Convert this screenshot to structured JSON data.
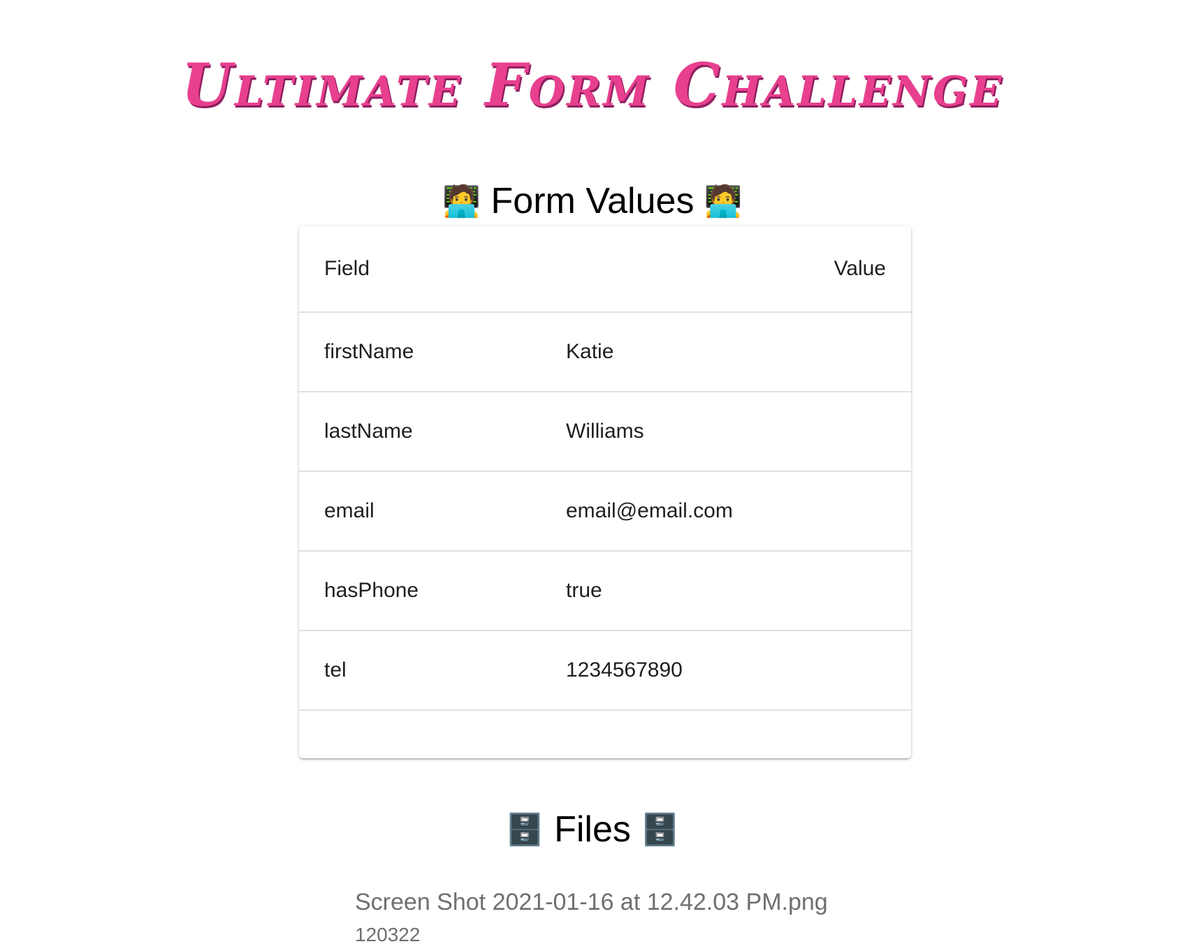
{
  "title": "Ultimate Form Challenge",
  "form_values": {
    "heading_emoji": "🧑‍💻",
    "heading": "Form Values",
    "columns": [
      "Field",
      "Value"
    ],
    "rows": [
      {
        "field": "firstName",
        "value": "Katie"
      },
      {
        "field": "lastName",
        "value": "Williams"
      },
      {
        "field": "email",
        "value": "email@email.com"
      },
      {
        "field": "hasPhone",
        "value": "true"
      },
      {
        "field": "tel",
        "value": "1234567890"
      }
    ]
  },
  "files": {
    "heading_emoji": "🗄️",
    "heading": "Files",
    "items": [
      {
        "name": "Screen Shot 2021-01-16 at 12.42.03 PM.png",
        "size": "120322"
      }
    ]
  },
  "colors": {
    "title": "#e8408f",
    "title_shadow": "#8f1f60",
    "file_text": "#6f6f6f"
  }
}
